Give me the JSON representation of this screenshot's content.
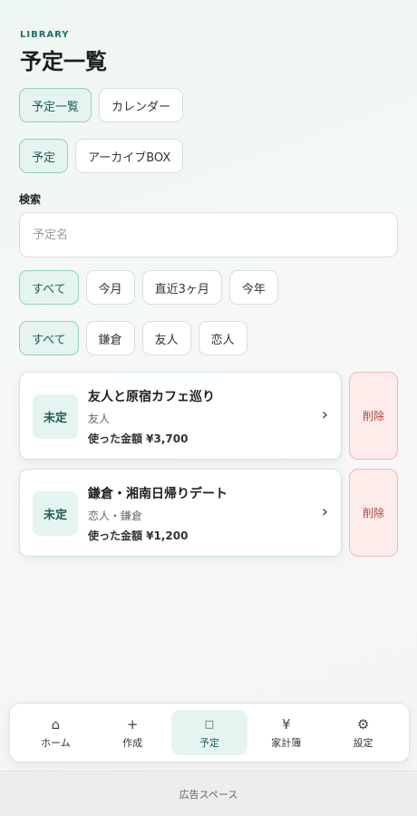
{
  "header": {
    "eyebrow": "LIBRARY",
    "title": "予定一覧"
  },
  "view_tabs": [
    "予定一覧",
    "カレンダー"
  ],
  "kind_tabs": [
    "予定",
    "アーカイブBOX"
  ],
  "search": {
    "label": "検索",
    "placeholder": "予定名"
  },
  "period_filters": [
    "すべて",
    "今月",
    "直近3ヶ月",
    "今年"
  ],
  "tag_filters": [
    "すべて",
    "鎌倉",
    "友人",
    "恋人"
  ],
  "schedules": [
    {
      "status": "未定",
      "title": "友人と原宿カフェ巡り",
      "tags": "友人",
      "amount": "使った金額 ¥3,700",
      "delete_label": "削除"
    },
    {
      "status": "未定",
      "title": "鎌倉・湘南日帰りデート",
      "tags": "恋人・鎌倉",
      "amount": "使った金額 ¥1,200",
      "delete_label": "削除"
    }
  ],
  "bottom_nav": [
    {
      "icon": "home-icon",
      "label": "ホーム"
    },
    {
      "icon": "plus-icon",
      "label": "作成"
    },
    {
      "icon": "square-icon",
      "label": "予定"
    },
    {
      "icon": "yen-icon",
      "label": "家計簿"
    },
    {
      "icon": "gear-icon",
      "label": "設定"
    }
  ],
  "active_nav": "予定",
  "ad_text": "広告スペース",
  "colors": {
    "accent": "#1e5e54",
    "accent_bg": "#e6f4f1",
    "delete": "#b0463a"
  }
}
